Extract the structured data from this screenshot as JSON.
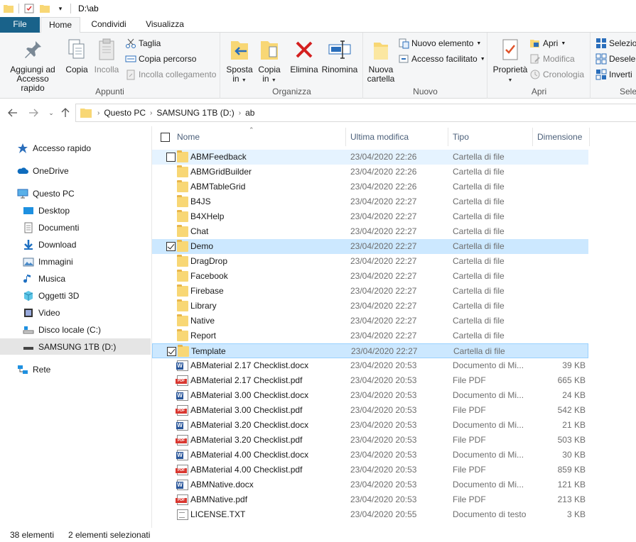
{
  "titlebar": {
    "path": "D:\\ab"
  },
  "tabs": {
    "file": "File",
    "home": "Home",
    "share": "Condividi",
    "view": "Visualizza"
  },
  "ribbon": {
    "clipboard": {
      "name": "Appunti",
      "pin": "Aggiungi ad\nAccesso rapido",
      "pin_line1": "Aggiungi ad",
      "pin_line2": "Accesso rapido",
      "copy": "Copia",
      "paste": "Incolla",
      "cut": "Taglia",
      "copy_path": "Copia percorso",
      "paste_shortcut": "Incolla collegamento"
    },
    "organize": {
      "name": "Organizza",
      "move_line1": "Sposta",
      "move_line2": "in",
      "copyto_line1": "Copia",
      "copyto_line2": "in",
      "delete": "Elimina",
      "rename": "Rinomina"
    },
    "new": {
      "name": "Nuovo",
      "new_folder_line1": "Nuova",
      "new_folder_line2": "cartella",
      "new_item": "Nuovo elemento",
      "easy_access": "Accesso facilitato"
    },
    "open": {
      "name": "Apri",
      "properties": "Proprietà",
      "open": "Apri",
      "edit": "Modifica",
      "history": "Cronologia"
    },
    "select": {
      "name": "Sele",
      "select_all": "Selezio",
      "select_none": "Desele",
      "invert": "Inverti"
    }
  },
  "address": {
    "crumbs": [
      "Questo PC",
      "SAMSUNG 1TB (D:)",
      "ab"
    ]
  },
  "navpane": [
    {
      "label": "Accesso rapido",
      "icon": "star-icon"
    },
    {
      "label": "OneDrive",
      "icon": "cloud-icon"
    },
    {
      "label": "Questo PC",
      "icon": "pc-icon"
    },
    {
      "label": "Desktop",
      "icon": "desktop-icon"
    },
    {
      "label": "Documenti",
      "icon": "documents-icon"
    },
    {
      "label": "Download",
      "icon": "download-icon"
    },
    {
      "label": "Immagini",
      "icon": "pictures-icon"
    },
    {
      "label": "Musica",
      "icon": "music-icon"
    },
    {
      "label": "Oggetti 3D",
      "icon": "objects3d-icon"
    },
    {
      "label": "Video",
      "icon": "video-icon"
    },
    {
      "label": "Disco locale (C:)",
      "icon": "drive-c-icon"
    },
    {
      "label": "SAMSUNG 1TB (D:)",
      "icon": "drive-d-icon"
    },
    {
      "label": "Rete",
      "icon": "network-icon"
    }
  ],
  "columns": {
    "name": "Nome",
    "modified": "Ultima modifica",
    "type": "Tipo",
    "size": "Dimensione"
  },
  "files": [
    {
      "name": "ABMFeedback",
      "date": "23/04/2020 22:26",
      "type": "Cartella di file",
      "size": "",
      "kind": "folder"
    },
    {
      "name": "ABMGridBuilder",
      "date": "23/04/2020 22:26",
      "type": "Cartella di file",
      "size": "",
      "kind": "folder"
    },
    {
      "name": "ABMTableGrid",
      "date": "23/04/2020 22:26",
      "type": "Cartella di file",
      "size": "",
      "kind": "folder"
    },
    {
      "name": "B4JS",
      "date": "23/04/2020 22:27",
      "type": "Cartella di file",
      "size": "",
      "kind": "folder"
    },
    {
      "name": "B4XHelp",
      "date": "23/04/2020 22:27",
      "type": "Cartella di file",
      "size": "",
      "kind": "folder"
    },
    {
      "name": "Chat",
      "date": "23/04/2020 22:27",
      "type": "Cartella di file",
      "size": "",
      "kind": "folder"
    },
    {
      "name": "Demo",
      "date": "23/04/2020 22:27",
      "type": "Cartella di file",
      "size": "",
      "kind": "folder"
    },
    {
      "name": "DragDrop",
      "date": "23/04/2020 22:27",
      "type": "Cartella di file",
      "size": "",
      "kind": "folder"
    },
    {
      "name": "Facebook",
      "date": "23/04/2020 22:27",
      "type": "Cartella di file",
      "size": "",
      "kind": "folder"
    },
    {
      "name": "Firebase",
      "date": "23/04/2020 22:27",
      "type": "Cartella di file",
      "size": "",
      "kind": "folder"
    },
    {
      "name": "Library",
      "date": "23/04/2020 22:27",
      "type": "Cartella di file",
      "size": "",
      "kind": "folder"
    },
    {
      "name": "Native",
      "date": "23/04/2020 22:27",
      "type": "Cartella di file",
      "size": "",
      "kind": "folder"
    },
    {
      "name": "Report",
      "date": "23/04/2020 22:27",
      "type": "Cartella di file",
      "size": "",
      "kind": "folder"
    },
    {
      "name": "Template",
      "date": "23/04/2020 22:27",
      "type": "Cartella di file",
      "size": "",
      "kind": "folder"
    },
    {
      "name": "ABMaterial 2.17 Checklist.docx",
      "date": "23/04/2020 20:53",
      "type": "Documento di Mi...",
      "size": "39 KB",
      "kind": "docx"
    },
    {
      "name": "ABMaterial 2.17 Checklist.pdf",
      "date": "23/04/2020 20:53",
      "type": "File PDF",
      "size": "665 KB",
      "kind": "pdf"
    },
    {
      "name": "ABMaterial 3.00 Checklist.docx",
      "date": "23/04/2020 20:53",
      "type": "Documento di Mi...",
      "size": "24 KB",
      "kind": "docx"
    },
    {
      "name": "ABMaterial 3.00 Checklist.pdf",
      "date": "23/04/2020 20:53",
      "type": "File PDF",
      "size": "542 KB",
      "kind": "pdf"
    },
    {
      "name": "ABMaterial 3.20 Checklist.docx",
      "date": "23/04/2020 20:53",
      "type": "Documento di Mi...",
      "size": "21 KB",
      "kind": "docx"
    },
    {
      "name": "ABMaterial 3.20 Checklist.pdf",
      "date": "23/04/2020 20:53",
      "type": "File PDF",
      "size": "503 KB",
      "kind": "pdf"
    },
    {
      "name": "ABMaterial 4.00 Checklist.docx",
      "date": "23/04/2020 20:53",
      "type": "Documento di Mi...",
      "size": "30 KB",
      "kind": "docx"
    },
    {
      "name": "ABMaterial 4.00 Checklist.pdf",
      "date": "23/04/2020 20:53",
      "type": "File PDF",
      "size": "859 KB",
      "kind": "pdf"
    },
    {
      "name": "ABMNative.docx",
      "date": "23/04/2020 20:53",
      "type": "Documento di Mi...",
      "size": "121 KB",
      "kind": "docx"
    },
    {
      "name": "ABMNative.pdf",
      "date": "23/04/2020 20:53",
      "type": "File PDF",
      "size": "213 KB",
      "kind": "pdf"
    },
    {
      "name": "LICENSE.TXT",
      "date": "23/04/2020 20:55",
      "type": "Documento di testo",
      "size": "3 KB",
      "kind": "txt"
    }
  ],
  "status": {
    "count": "38 elementi",
    "selected": "2 elementi selezionati"
  }
}
